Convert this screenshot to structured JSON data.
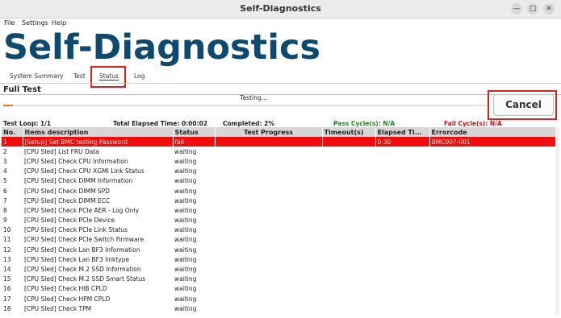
{
  "window": {
    "title": "Self-Diagnostics"
  },
  "menu": [
    "File",
    "Settings",
    "Help"
  ],
  "app_title": "Self-Diagnostics",
  "tabs": [
    "System Summary",
    "Test",
    "Status",
    "Log"
  ],
  "active_tab": "Status",
  "section_title": "Full Test",
  "status_text": "Testing...",
  "progress_fraction": 0.02,
  "cancel_label": "Cancel",
  "stats": {
    "test_loop": "Test Loop: 1/1",
    "elapsed": "Total Elapsed Time: 0:00:02",
    "completed": "Completed: 2%",
    "pass": "Pass Cycle(s): N/A",
    "fail": "Fail Cycle(s): N/A"
  },
  "colors": {
    "pass": "#1a8a1a",
    "fail": "#d01010",
    "logo": "#0e4a6e",
    "fail_row": "#ef0d0d"
  },
  "table": {
    "headers": [
      "No.",
      "Items description",
      "Status",
      "Test Progress",
      "Timeout(s)",
      "Elapsed Ti...",
      "Errorcode"
    ],
    "rows": [
      [
        "1",
        "[Setup] Set BMC testing Password",
        "fail",
        "",
        "",
        "0.30",
        "BMC007-001"
      ],
      [
        "2",
        "[CPU Sled] List FRU Data",
        "waiting",
        "",
        "",
        "",
        ""
      ],
      [
        "3",
        "[CPU Sled] Check CPU Information",
        "waiting",
        "",
        "",
        "",
        ""
      ],
      [
        "4",
        "[CPU Sled] Check CPU XGMI Link Status",
        "waiting",
        "",
        "",
        "",
        ""
      ],
      [
        "5",
        "[CPU Sled] Check DIMM Information",
        "waiting",
        "",
        "",
        "",
        ""
      ],
      [
        "6",
        "[CPU Sled] Check DIMM SPD",
        "waiting",
        "",
        "",
        "",
        ""
      ],
      [
        "7",
        "[CPU Sled] Check DIMM ECC",
        "waiting",
        "",
        "",
        "",
        ""
      ],
      [
        "8",
        "[CPU Sled] Check PCIe AER - Log Only",
        "waiting",
        "",
        "",
        "",
        ""
      ],
      [
        "9",
        "[CPU Sled] Check PCIe Device",
        "waiting",
        "",
        "",
        "",
        ""
      ],
      [
        "10",
        "[CPU Sled] Check PCIe Link Status",
        "waiting",
        "",
        "",
        "",
        ""
      ],
      [
        "11",
        "[CPU Sled] Check PCIe Switch Firmware",
        "waiting",
        "",
        "",
        "",
        ""
      ],
      [
        "12",
        "[CPU Sled] Check Lan BF3 Information",
        "waiting",
        "",
        "",
        "",
        ""
      ],
      [
        "13",
        "[CPU Sled] Check Lan BF3 linktype",
        "waiting",
        "",
        "",
        "",
        ""
      ],
      [
        "14",
        "[CPU Sled] Check M.2 SSD Information",
        "waiting",
        "",
        "",
        "",
        ""
      ],
      [
        "15",
        "[CPU Sled] Check M.2 SSD Smart Status",
        "waiting",
        "",
        "",
        "",
        ""
      ],
      [
        "16",
        "[CPU Sled] Check HIB CPLD",
        "waiting",
        "",
        "",
        "",
        ""
      ],
      [
        "17",
        "[CPU Sled] Check HPM CPLD",
        "waiting",
        "",
        "",
        "",
        ""
      ],
      [
        "18",
        "[CPU Sled] Check TPM",
        "waiting",
        "",
        "",
        "",
        ""
      ]
    ]
  }
}
